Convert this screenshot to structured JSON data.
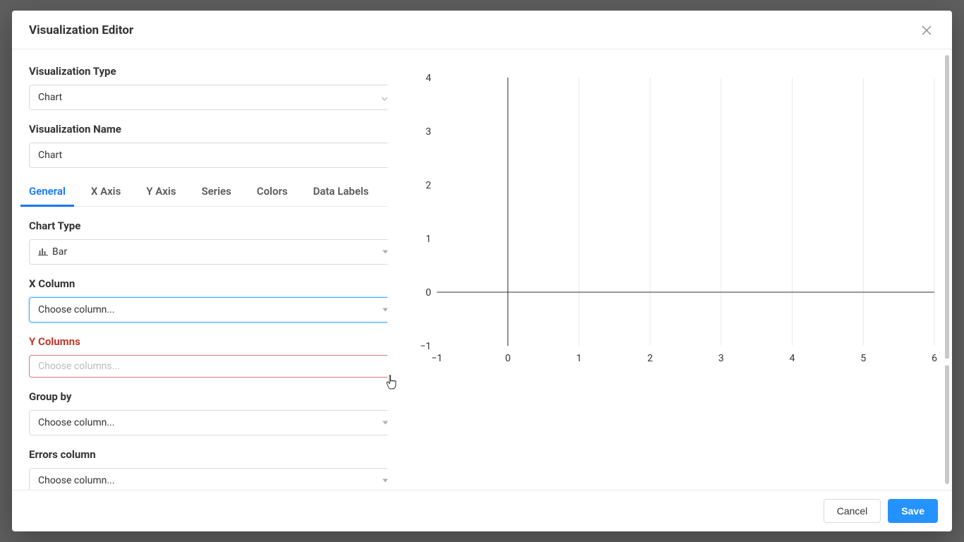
{
  "modal": {
    "title": "Visualization Editor"
  },
  "form": {
    "vizTypeLabel": "Visualization Type",
    "vizTypeValue": "Chart",
    "vizNameLabel": "Visualization Name",
    "vizNameValue": "Chart",
    "chartTypeLabel": "Chart Type",
    "chartTypeValue": "Bar",
    "xColumnLabel": "X Column",
    "xColumnPlaceholder": "Choose column...",
    "yColumnsLabel": "Y Columns",
    "yColumnsPlaceholder": "Choose columns...",
    "groupByLabel": "Group by",
    "groupByPlaceholder": "Choose column...",
    "errorsLabel": "Errors column",
    "errorsPlaceholder": "Choose column..."
  },
  "tabs": [
    "General",
    "X Axis",
    "Y Axis",
    "Series",
    "Colors",
    "Data Labels"
  ],
  "footer": {
    "cancel": "Cancel",
    "save": "Save"
  },
  "chart_data": {
    "type": "bar",
    "title": "",
    "xlabel": "",
    "ylabel": "",
    "xlim": [
      -1,
      6
    ],
    "ylim": [
      -1,
      4
    ],
    "x_ticks": [
      -1,
      0,
      1,
      2,
      3,
      4,
      5,
      6
    ],
    "y_ticks": [
      -1,
      0,
      1,
      2,
      3,
      4
    ],
    "series": [],
    "categories": [],
    "values": []
  }
}
